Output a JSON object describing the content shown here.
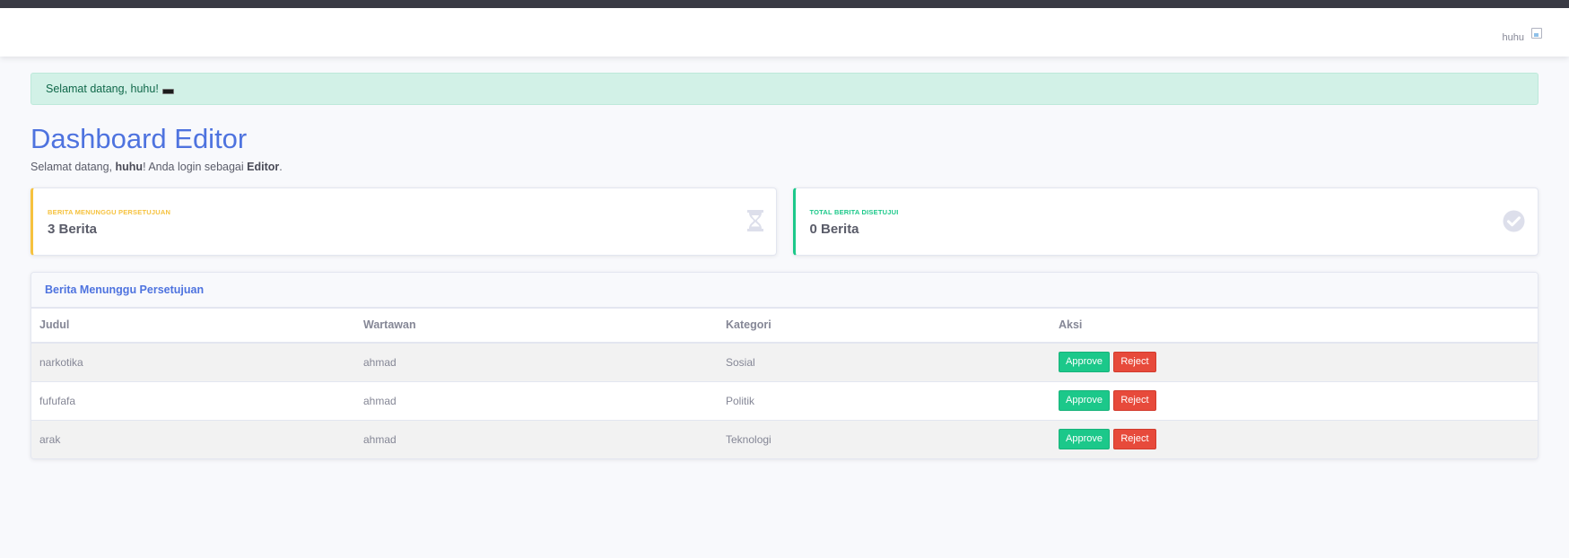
{
  "topbar": {
    "username": "huhu"
  },
  "alert": {
    "message": "Selamat datang, huhu!"
  },
  "page": {
    "title": "Dashboard Editor",
    "subtitle_prefix": "Selamat datang, ",
    "subtitle_user": "huhu",
    "subtitle_middle": "! Anda login sebagai ",
    "subtitle_role": "Editor",
    "subtitle_suffix": "."
  },
  "cards": [
    {
      "label": "BERITA MENUNGGU PERSETUJUAN",
      "value": "3 Berita",
      "icon": "hourglass-icon",
      "color": "#f6c23e"
    },
    {
      "label": "TOTAL BERITA DISETUJUI",
      "value": "0 Berita",
      "icon": "check-circle-icon",
      "color": "#1cc88a"
    }
  ],
  "pending_table": {
    "title": "Berita Menunggu Persetujuan",
    "columns": [
      "Judul",
      "Wartawan",
      "Kategori",
      "Aksi"
    ],
    "rows": [
      {
        "judul": "narkotika",
        "wartawan": "ahmad",
        "kategori": "Sosial"
      },
      {
        "judul": "fufufafa",
        "wartawan": "ahmad",
        "kategori": "Politik"
      },
      {
        "judul": "arak",
        "wartawan": "ahmad",
        "kategori": "Teknologi"
      }
    ],
    "approve_label": "Approve",
    "reject_label": "Reject"
  },
  "colors": {
    "primary": "#4e73df",
    "success": "#1cc88a",
    "warning": "#f6c23e",
    "danger": "#e74a3b"
  }
}
